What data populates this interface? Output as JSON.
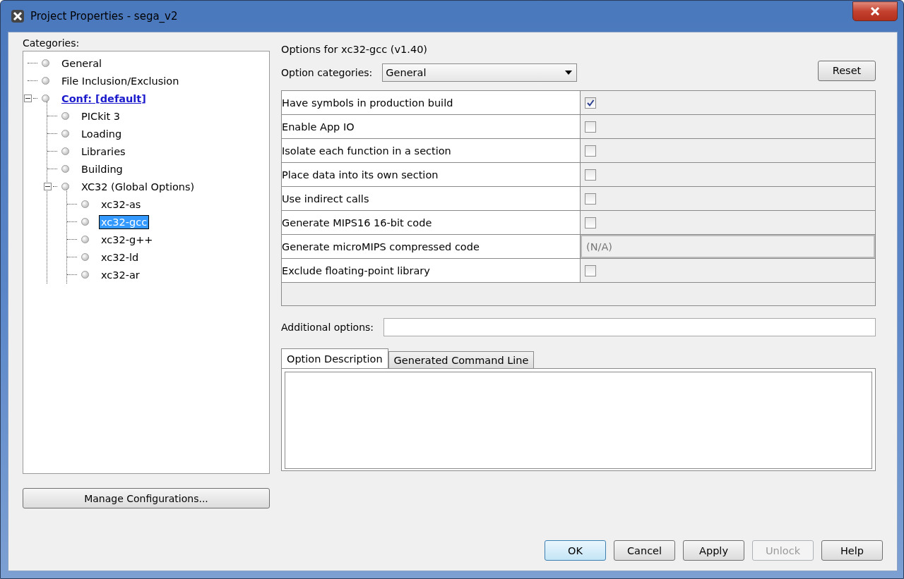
{
  "window": {
    "title": "Project Properties - sega_v2"
  },
  "categories": {
    "label": "Categories:",
    "tree": [
      {
        "label": "General",
        "kind": "node",
        "selected": false
      },
      {
        "label": "File Inclusion/Exclusion",
        "kind": "node",
        "selected": false
      },
      {
        "label": "Conf: [default]",
        "kind": "config",
        "selected": false,
        "expanded": true,
        "children": [
          {
            "label": "PICkit 3",
            "kind": "node",
            "selected": false
          },
          {
            "label": "Loading",
            "kind": "node",
            "selected": false
          },
          {
            "label": "Libraries",
            "kind": "node",
            "selected": false
          },
          {
            "label": "Building",
            "kind": "node",
            "selected": false
          },
          {
            "label": "XC32 (Global Options)",
            "kind": "node",
            "selected": false,
            "expanded": true,
            "children": [
              {
                "label": "xc32-as",
                "kind": "node",
                "selected": false
              },
              {
                "label": "xc32-gcc",
                "kind": "node",
                "selected": true
              },
              {
                "label": "xc32-g++",
                "kind": "node",
                "selected": false
              },
              {
                "label": "xc32-ld",
                "kind": "node",
                "selected": false
              },
              {
                "label": "xc32-ar",
                "kind": "node",
                "selected": false
              }
            ]
          }
        ]
      }
    ]
  },
  "manage_button": "Manage Configurations...",
  "options": {
    "heading": "Options for xc32-gcc (v1.40)",
    "category_label": "Option categories:",
    "category_value": "General",
    "reset_button": "Reset",
    "rows": [
      {
        "label": "Have symbols in production build",
        "kind": "checkbox",
        "checked": true
      },
      {
        "label": "Enable App IO",
        "kind": "checkbox",
        "checked": false
      },
      {
        "label": "Isolate each function in a section",
        "kind": "checkbox",
        "checked": false
      },
      {
        "label": "Place data into its own section",
        "kind": "checkbox",
        "checked": false
      },
      {
        "label": "Use indirect calls",
        "kind": "checkbox",
        "checked": false
      },
      {
        "label": "Generate MIPS16 16-bit code",
        "kind": "checkbox",
        "checked": false
      },
      {
        "label": "Generate microMIPS compressed code",
        "kind": "text",
        "value": "(N/A)"
      },
      {
        "label": "Exclude floating-point library",
        "kind": "checkbox",
        "checked": false
      }
    ],
    "additional_label": "Additional options:",
    "tabs": [
      {
        "label": "Option Description",
        "selected": true
      },
      {
        "label": "Generated Command Line",
        "selected": false
      }
    ]
  },
  "buttons": [
    {
      "label": "OK",
      "default": true,
      "disabled": false
    },
    {
      "label": "Cancel",
      "default": false,
      "disabled": false
    },
    {
      "label": "Apply",
      "default": false,
      "disabled": false
    },
    {
      "label": "Unlock",
      "default": false,
      "disabled": true
    },
    {
      "label": "Help",
      "default": false,
      "disabled": false
    }
  ]
}
